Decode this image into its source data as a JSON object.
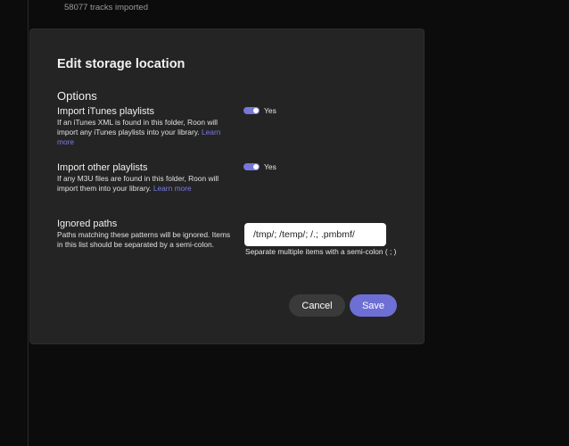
{
  "background": {
    "status_line_1": "...",
    "status_line_2": "58077 tracks imported"
  },
  "dialog": {
    "title": "Edit storage location",
    "section_title": "Options",
    "import_itunes": {
      "label": "Import iTunes playlists",
      "description": "If an iTunes XML is found in this folder, Roon will import any iTunes playlists into your library.",
      "learn_more": "Learn more",
      "toggle_on": true,
      "toggle_text": "Yes"
    },
    "import_other": {
      "label": "Import other playlists",
      "description": "If any M3U files are found in this folder, Roon will import them into your library.",
      "learn_more": "Learn more",
      "toggle_on": true,
      "toggle_text": "Yes"
    },
    "ignored_paths": {
      "label": "Ignored paths",
      "description": "Paths matching these patterns will be ignored. Items in this list should be separated by a semi-colon.",
      "value": "/tmp/; /temp/; /.; .pmbmf/",
      "help": "Separate multiple items with a semi-colon ( ; )"
    },
    "buttons": {
      "cancel": "Cancel",
      "save": "Save"
    }
  },
  "colors": {
    "accent": "#6e6fd5",
    "link": "#7b7be6",
    "dialog_bg": "#242424",
    "page_bg": "#0c0c0c"
  }
}
